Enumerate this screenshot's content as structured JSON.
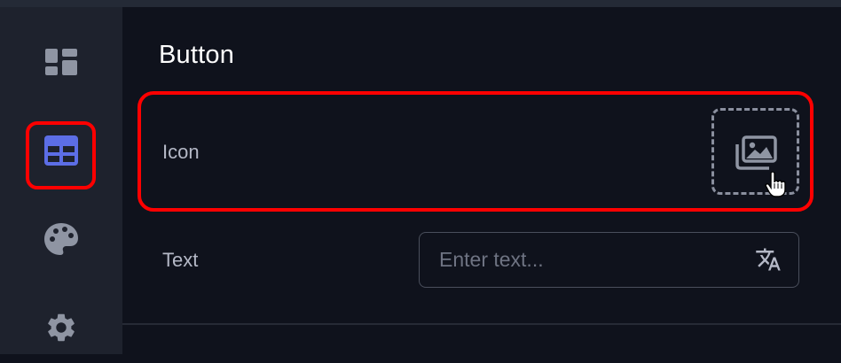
{
  "sidebar": {
    "items": [
      {
        "name": "dashboard",
        "icon": "dashboard-icon"
      },
      {
        "name": "layout",
        "icon": "table-layout-icon",
        "active": true
      },
      {
        "name": "theme",
        "icon": "palette-icon"
      },
      {
        "name": "settings",
        "icon": "gear-icon"
      }
    ]
  },
  "section": {
    "title": "Button"
  },
  "fields": {
    "icon": {
      "label": "Icon",
      "picker_icon": "images-icon"
    },
    "text": {
      "label": "Text",
      "value": "",
      "placeholder": "Enter text...",
      "action_icon": "translate-icon"
    }
  },
  "colors": {
    "accent": "#5c6ee6",
    "highlight": "#ff0000",
    "background": "#0f121c",
    "sidebar": "#1e222d"
  }
}
